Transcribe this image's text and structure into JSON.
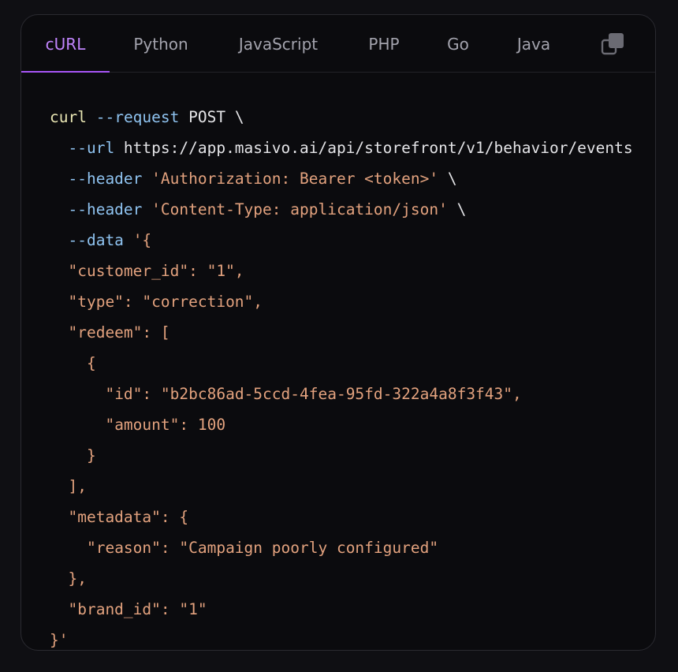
{
  "tabs": [
    {
      "label": "cURL",
      "active": true
    },
    {
      "label": "Python",
      "active": false
    },
    {
      "label": "JavaScript",
      "active": false
    },
    {
      "label": "PHP",
      "active": false
    },
    {
      "label": "Go",
      "active": false
    },
    {
      "label": "Java",
      "active": false
    }
  ],
  "copy_icon": "copy-icon",
  "colors": {
    "accent": "#c084fc",
    "command": "#e9e6b3",
    "flag": "#8fc3f0",
    "string": "#e3a27e",
    "text": "#e4e4e7",
    "background": "#0b0b0e"
  },
  "code": {
    "l1": {
      "cmd": "curl",
      "flag": "--request",
      "rest": " POST \\"
    },
    "l2": {
      "flag": "--url",
      "rest": " https://app.masivo.ai/api/storefront/v1/behavior/events"
    },
    "l3": {
      "flag": "--header",
      "str": "'Authorization: Bearer <token>'",
      "rest": " \\"
    },
    "l4": {
      "flag": "--header",
      "str": "'Content-Type: application/json'",
      "rest": " \\"
    },
    "l5": {
      "flag": "--data",
      "str": "'{"
    },
    "l6": "\"customer_id\": \"1\",",
    "l7": "\"type\": \"correction\",",
    "l8": "\"redeem\": [",
    "l9": "{",
    "l10": "\"id\": \"b2bc86ad-5ccd-4fea-95fd-322a4a8f3f43\",",
    "l11": "\"amount\": 100",
    "l12": "}",
    "l13": "],",
    "l14": "\"metadata\": {",
    "l15": "\"reason\": \"Campaign poorly configured\"",
    "l16": "},",
    "l17": "\"brand_id\": \"1\"",
    "l18": "}'"
  }
}
